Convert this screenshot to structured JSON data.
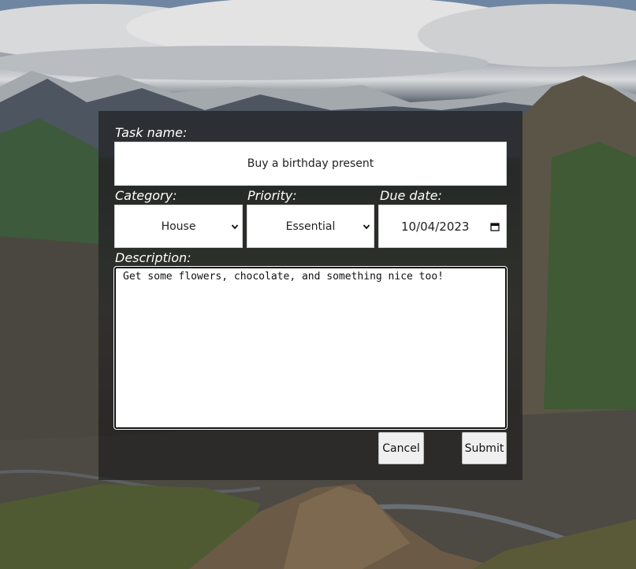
{
  "form": {
    "task_name": {
      "label": "Task name:",
      "value": "Buy a birthday present"
    },
    "category": {
      "label": "Category:",
      "value": "House",
      "icon": "chevron-down-icon"
    },
    "priority": {
      "label": "Priority:",
      "value": "Essential",
      "icon": "chevron-down-icon"
    },
    "due_date": {
      "label": "Due date:",
      "value": "10/04/2023",
      "icon": "calendar-icon"
    },
    "description": {
      "label": "Description:",
      "value": "Get some flowers, chocolate, and something nice too!"
    },
    "cancel_label": "Cancel",
    "submit_label": "Submit"
  },
  "colors": {
    "panel_background": "#191919",
    "label_text": "#ffffff",
    "field_background": "#ffffff",
    "button_background": "#f0f0f0"
  }
}
